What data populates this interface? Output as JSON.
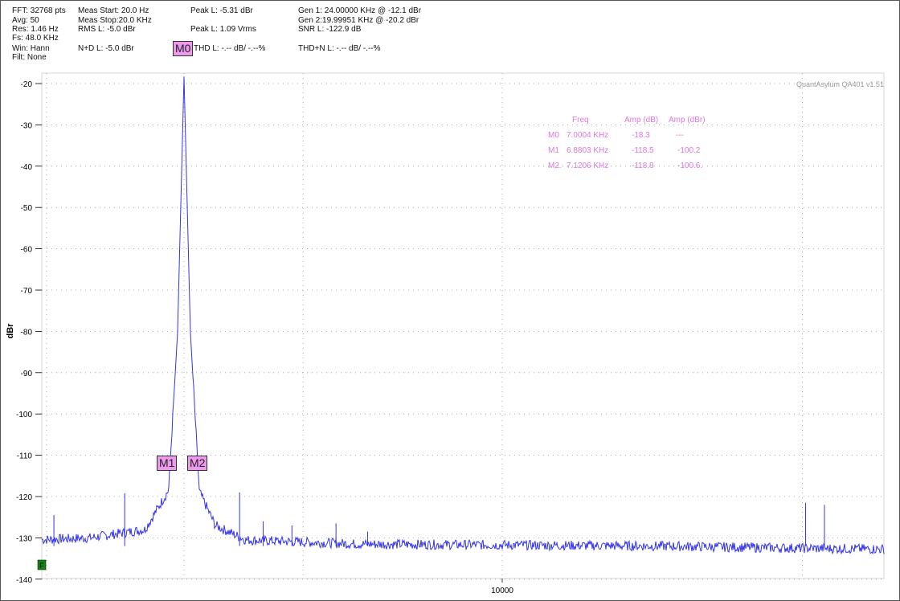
{
  "header": {
    "fft": "FFT: 32768 pts",
    "avg": "Avg: 50",
    "res": "Res: 1.46 Hz",
    "fs": "Fs: 48.0 KHz",
    "win": "Win: Hann",
    "filt": "Filt: None",
    "meas_start": "Meas Start: 20.0 Hz",
    "meas_stop": "Meas Stop:20.0 KHz",
    "rms": "RMS L: -5.0 dBr",
    "nd": "N+D L: -5.0 dBr",
    "peak1": "Peak L: -5.31 dBr",
    "peak2": "Peak L: 1.09 Vrms",
    "thd": "THD L: -.-- dB/ -.--%",
    "gen1": "Gen 1: 24.00000 KHz @ -12.1  dBr",
    "gen2": "Gen 2:19.99951 KHz @ -20.2  dBr",
    "snr": "SNR L: -122.9 dB",
    "thdn": "THD+N L: -.-- dB/ -.--%"
  },
  "watermark": "QuantAsylum QA401 v1.51",
  "markers": {
    "M0": "M0",
    "M1": "M1",
    "M2": "M2",
    "table": {
      "headers": [
        "Freq",
        "Amp (dB)",
        "Amp (dBr)"
      ],
      "rows": [
        [
          "M0",
          "7.0004 KHz",
          "-18.3",
          "---"
        ],
        [
          "M1",
          "6.8803 KHz",
          "-118.5",
          "-100.2"
        ],
        [
          "M2.",
          "7.1206 KHz",
          "-118.8",
          "-100.6."
        ]
      ]
    }
  },
  "footer_marker": "F",
  "colors": {
    "trace": "#3333ee",
    "marker_fill": "#ee99ee",
    "marker_text": "#dd77dd",
    "grid": "#999999"
  },
  "chart_data": {
    "type": "line",
    "ylabel": "dBr",
    "xlabel": "",
    "x_scale": "log",
    "ylim": [
      -140,
      -18
    ],
    "xlim": [
      20,
      24000
    ],
    "grid": true,
    "x_ticks": [
      10000
    ],
    "x_tick_labels": [
      "10000"
    ],
    "y_ticks": [
      -20,
      -30,
      -40,
      -50,
      -60,
      -70,
      -80,
      -90,
      -100,
      -110,
      -120,
      -130,
      -140
    ],
    "noise_floor": -132,
    "series": [
      {
        "points": [
          [
            20,
            -131.5
          ],
          [
            500,
            -131.5
          ],
          [
            1200,
            -131
          ],
          [
            2500,
            -131.5
          ],
          [
            3800,
            -131
          ],
          [
            4800,
            -130.5
          ],
          [
            5600,
            -131
          ],
          [
            6300,
            -130
          ],
          [
            6700,
            -128
          ],
          [
            6880,
            -118.5
          ],
          [
            6950,
            -80
          ],
          [
            7000,
            -18.3
          ],
          [
            7050,
            -80
          ],
          [
            7121,
            -118.8
          ],
          [
            7250,
            -127
          ],
          [
            7500,
            -130.5
          ],
          [
            8500,
            -131.5
          ],
          [
            12000,
            -132
          ],
          [
            14000,
            -132.5
          ],
          [
            17000,
            -133
          ],
          [
            21000,
            -133.5
          ],
          [
            24000,
            -134
          ]
        ],
        "spurs": [
          [
            5000,
            -126
          ],
          [
            5400,
            -125
          ],
          [
            5500,
            -126.5
          ],
          [
            6050,
            -124.5
          ],
          [
            6550,
            -119.2
          ],
          [
            7450,
            -119
          ],
          [
            7650,
            -126
          ],
          [
            7900,
            -127
          ],
          [
            8300,
            -126.5
          ],
          [
            8600,
            -128.5
          ],
          [
            14050,
            -121.5
          ],
          [
            14350,
            -122
          ],
          [
            20000,
            -127.5
          ],
          [
            20700,
            -128.5
          ],
          [
            21000,
            -128
          ],
          [
            21300,
            -128.2
          ],
          [
            22000,
            -127.5
          ]
        ]
      }
    ]
  }
}
